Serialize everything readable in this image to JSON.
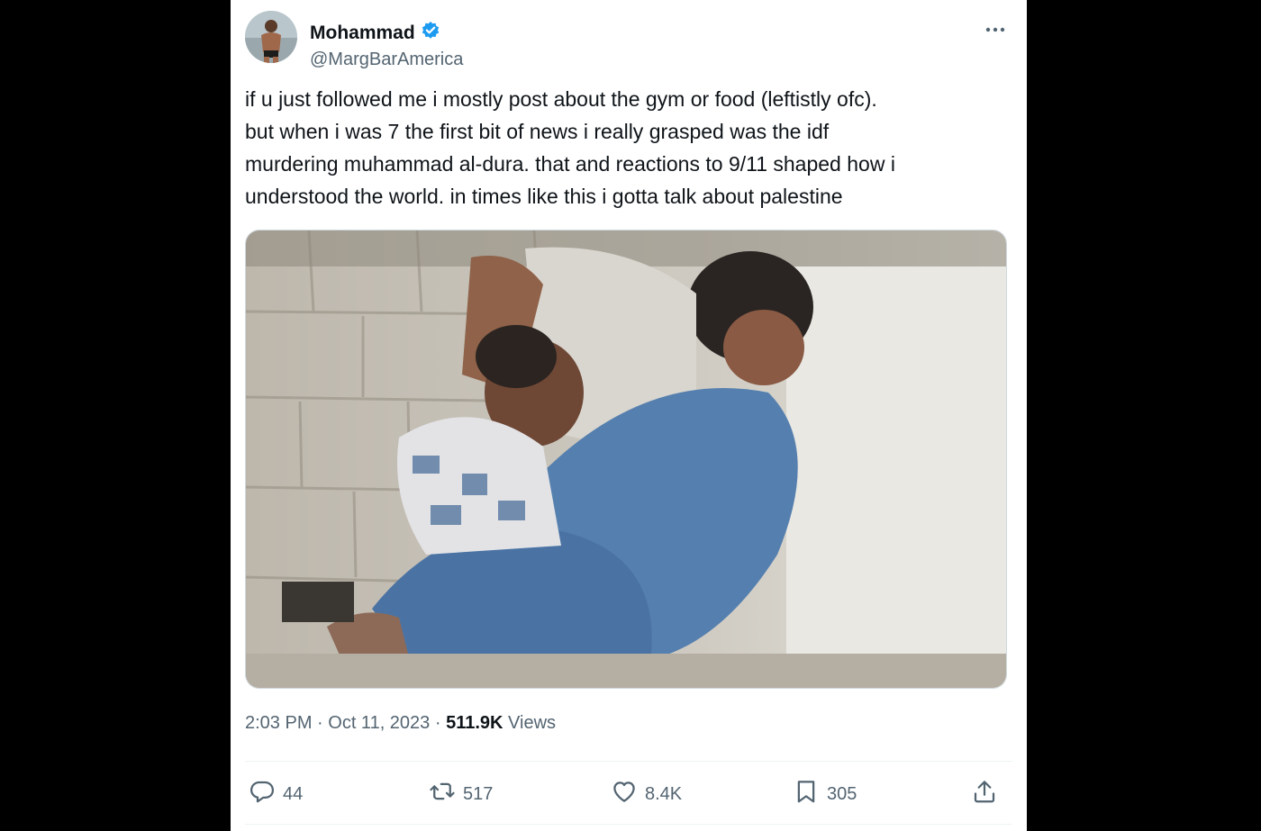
{
  "author": {
    "display_name": "Mohammad",
    "handle": "@MargBarAmerica",
    "verified_icon": "verified-badge-icon"
  },
  "tweet": {
    "text": "if u just followed me i mostly post about the gym or food (leftistly ofc).\nbut when i was 7 the first bit of news i really grasped was the idf\nmurdering muhammad al-dura. that and reactions to 9/11 shaped how i\nunderstood the world. in times like this i gotta talk about palestine"
  },
  "meta": {
    "time": "2:03 PM",
    "sep1": " · ",
    "date": "Oct 11, 2023",
    "sep2": " · ",
    "views_count": "511.9K",
    "views_label": " Views"
  },
  "actions": {
    "replies": "44",
    "reposts": "517",
    "likes": "8.4K",
    "bookmarks": "305"
  },
  "colors": {
    "accent": "#1d9bf0",
    "text_primary": "#0f1419",
    "text_secondary": "#536471"
  }
}
